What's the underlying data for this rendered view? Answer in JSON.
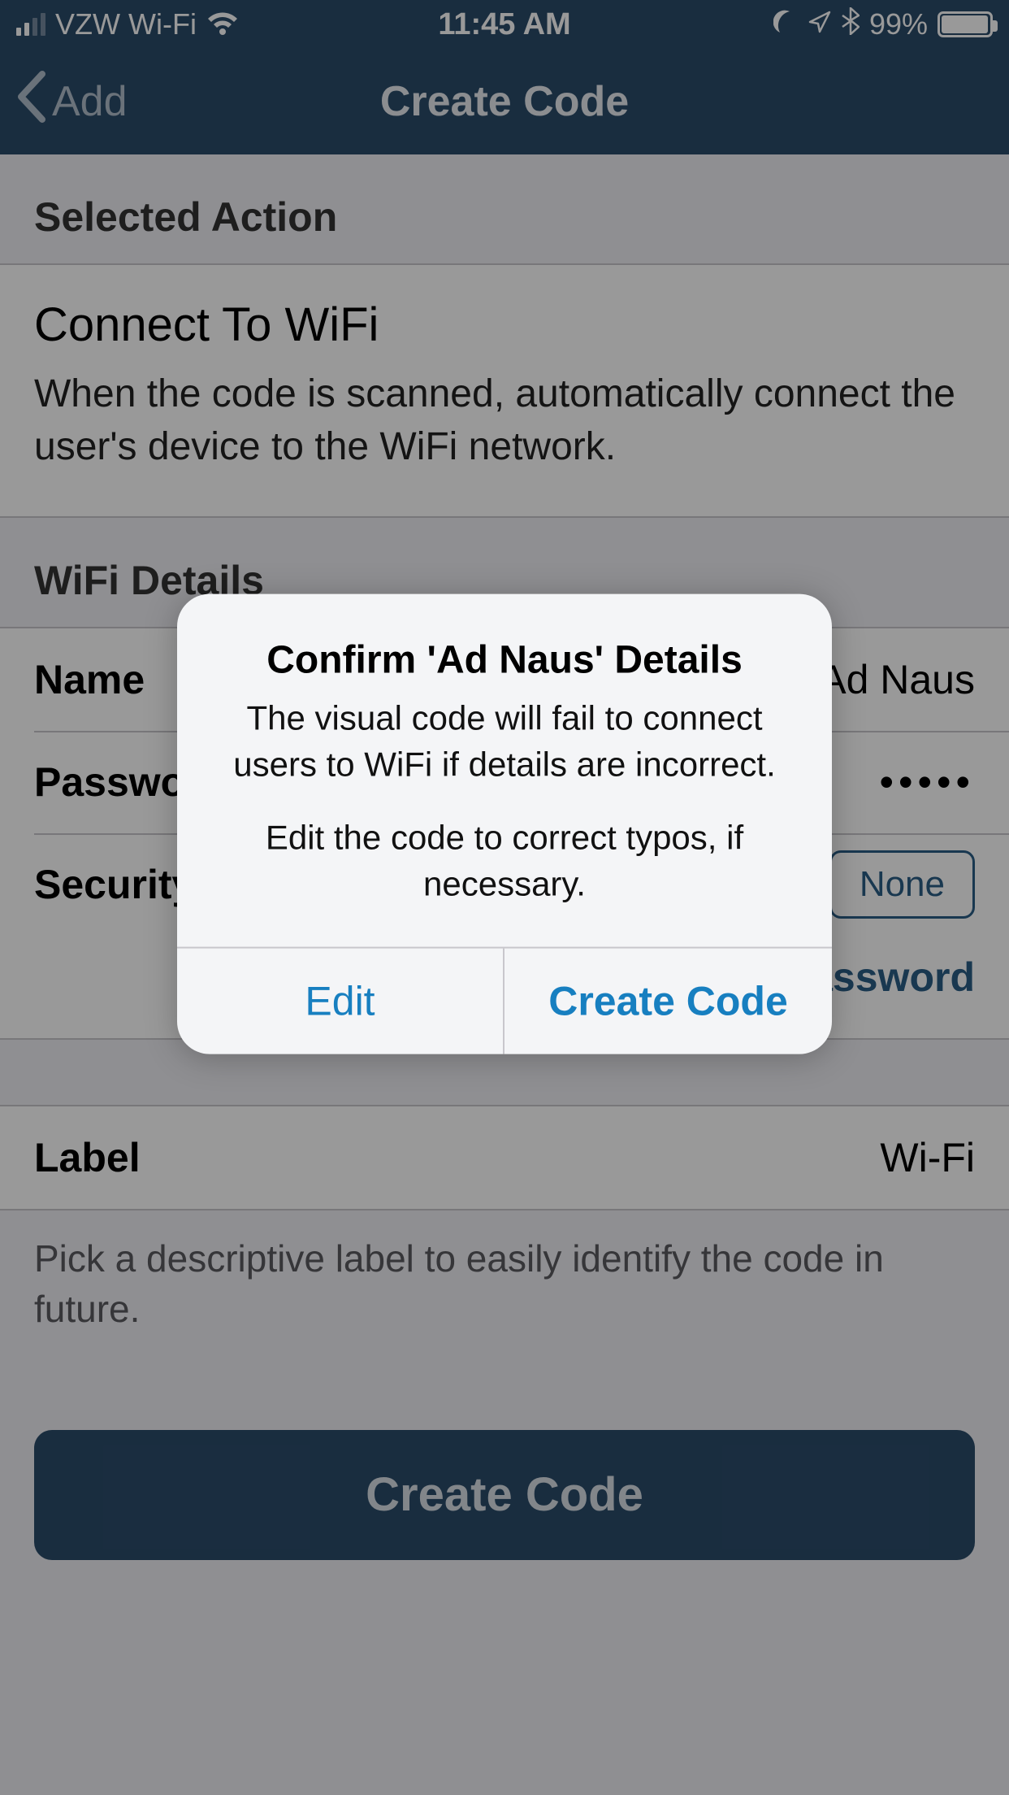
{
  "status_bar": {
    "carrier": "VZW Wi-Fi",
    "time": "11:45 AM",
    "battery_pct": "99%"
  },
  "nav": {
    "back_label": "Add",
    "title": "Create Code"
  },
  "action": {
    "section_header": "Selected Action",
    "title": "Connect To WiFi",
    "description": "When the code is scanned, automatically connect the user's device to the WiFi network."
  },
  "wifi": {
    "section_header": "WiFi Details",
    "name_key": "Name",
    "name_value": "Ad Naus",
    "pass_key": "Password",
    "pass_value": "•••••",
    "security_key": "Security",
    "security_value": "None",
    "show_password": "Show Password"
  },
  "label": {
    "key": "Label",
    "value": "Wi-Fi",
    "footer": "Pick a descriptive label to easily identify the code in future."
  },
  "primary_button": "Create Code",
  "alert": {
    "title": "Confirm 'Ad Naus' Details",
    "line1": "The visual code will fail to connect users to WiFi if details are incorrect.",
    "line2": "Edit the code to correct typos, if necessary.",
    "cancel": "Edit",
    "confirm": "Create Code"
  }
}
